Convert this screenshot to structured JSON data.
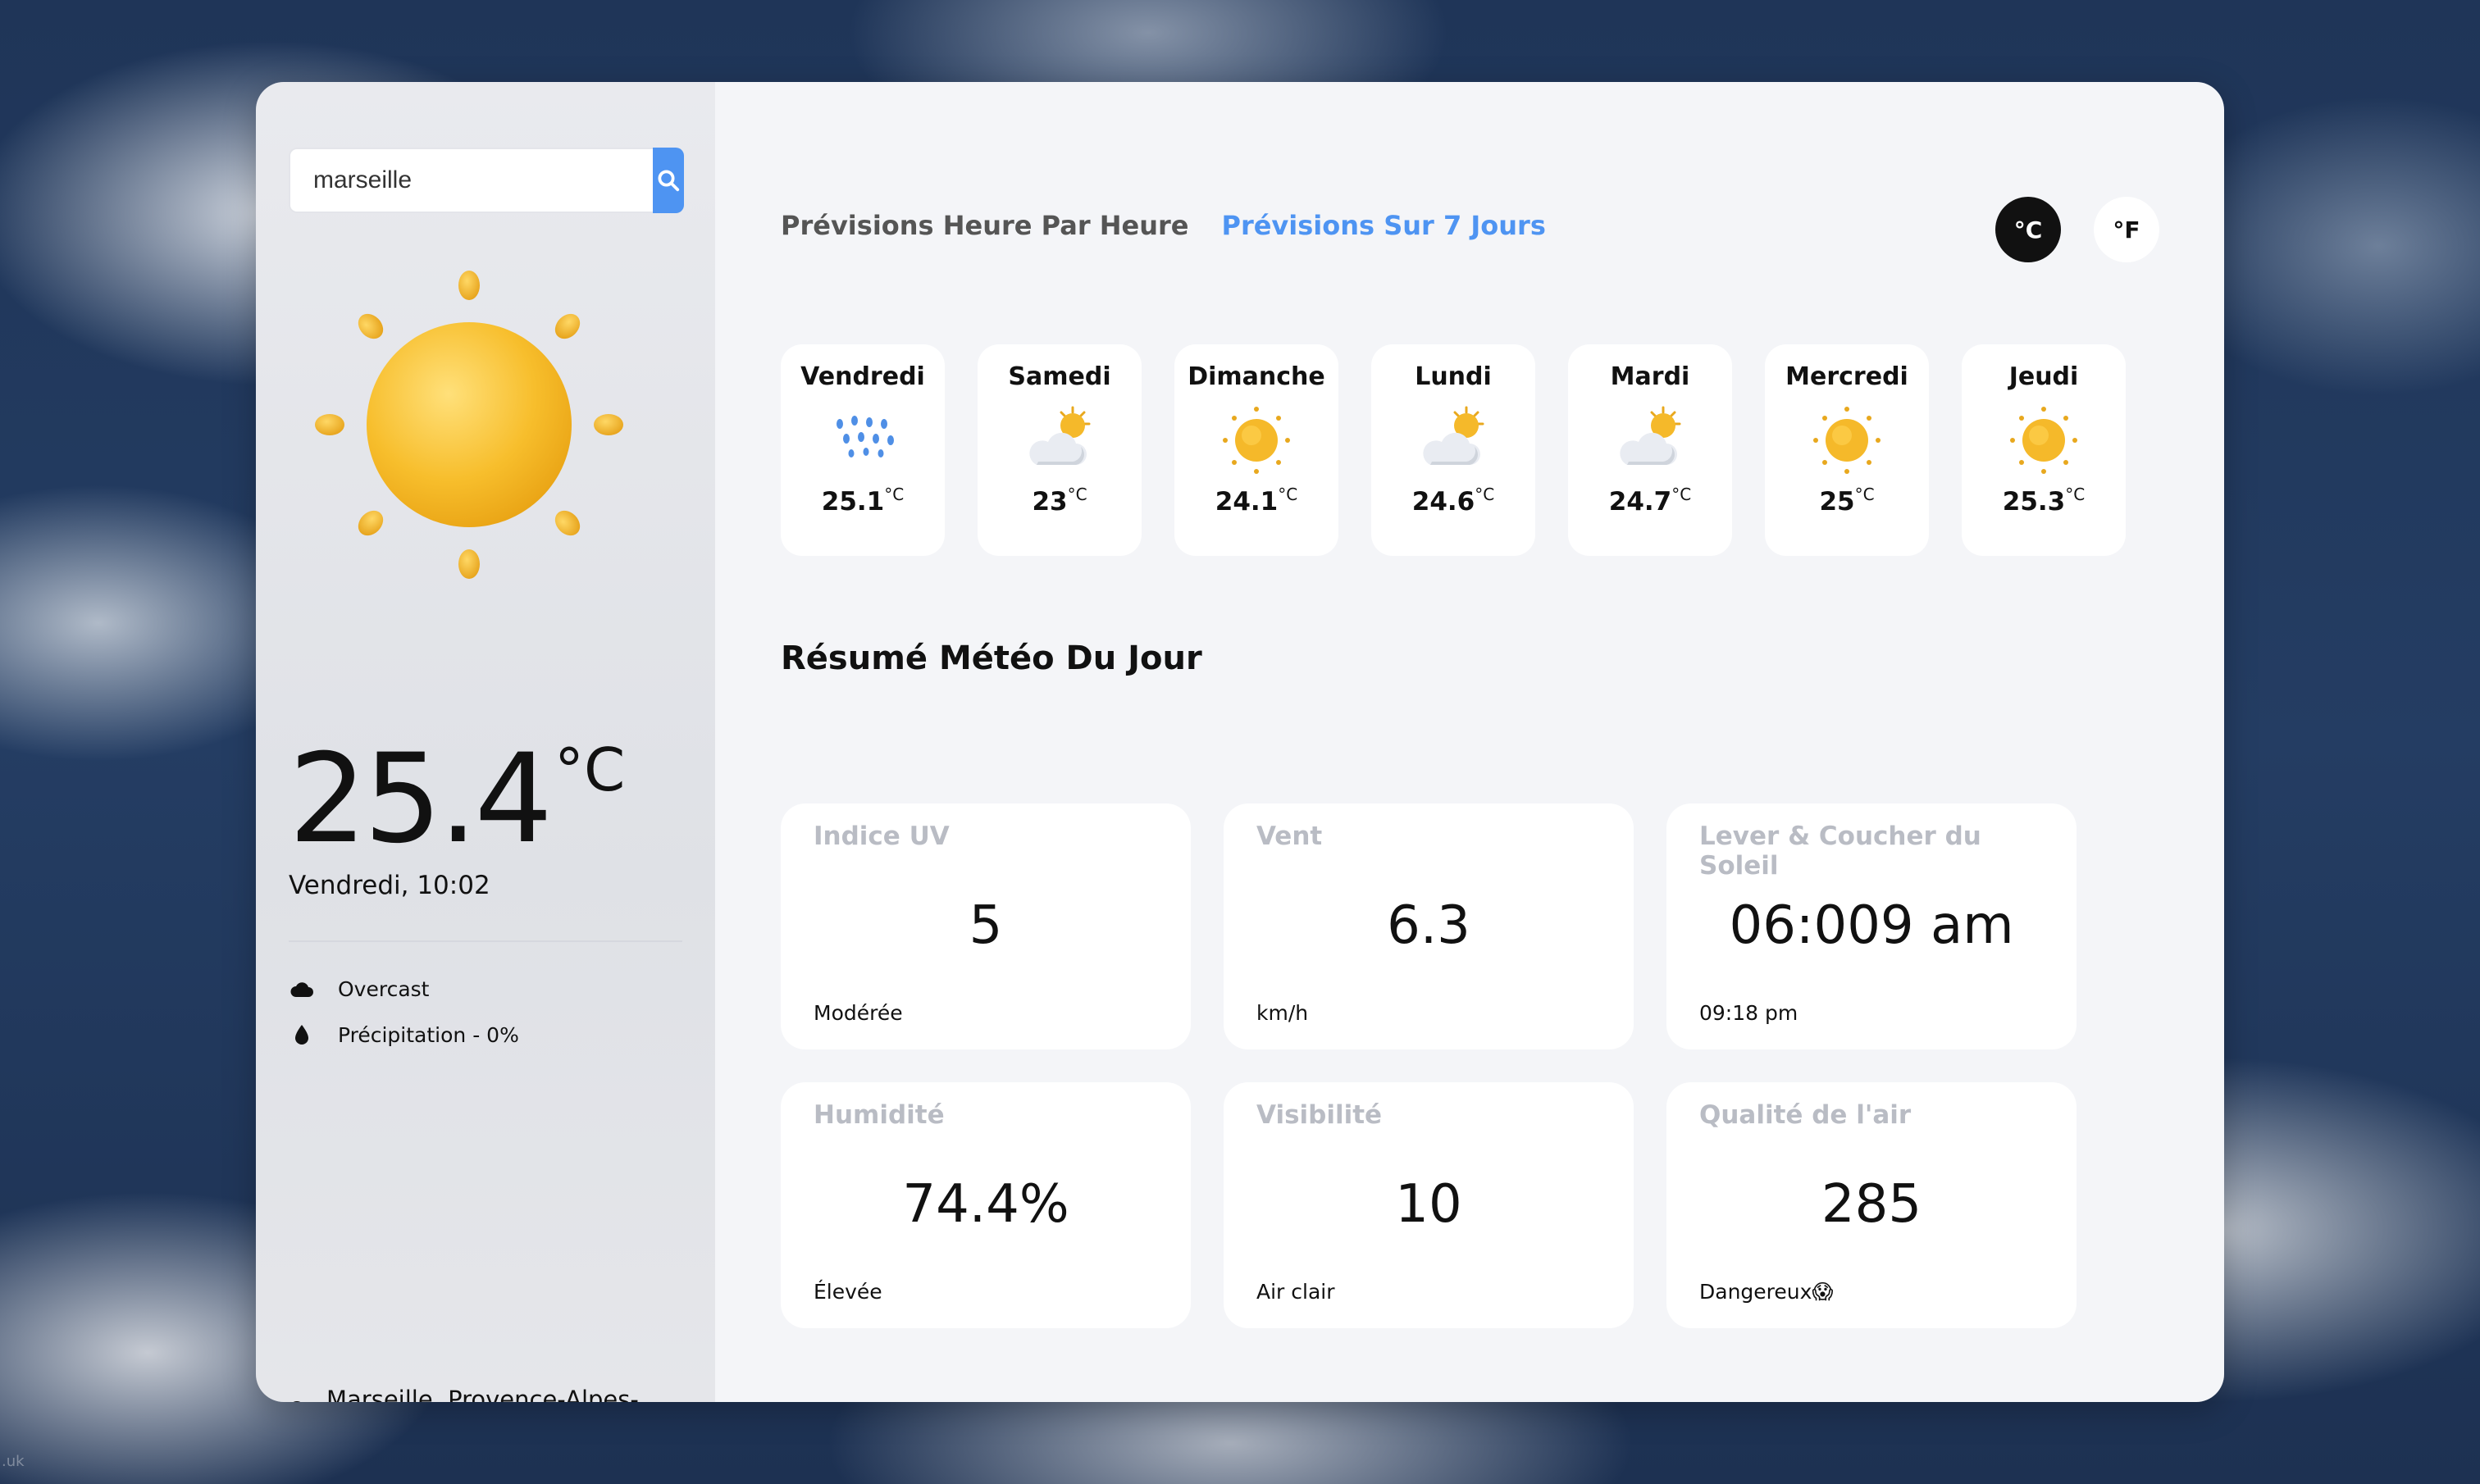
{
  "search": {
    "value": "marseille"
  },
  "current": {
    "temperature": "25.4",
    "unit": "°C",
    "datetime": "Vendredi, 10:02",
    "condition": "Overcast",
    "precipitation": "Précipitation - 0%",
    "location": "Marseille, Provence-Alpes-Côte d'Azur, France",
    "icon": "sun-icon"
  },
  "tabs": [
    {
      "label": "Prévisions Heure Par Heure",
      "active": false
    },
    {
      "label": "Prévisions Sur 7 Jours",
      "active": true
    }
  ],
  "units": {
    "celsius": "°C",
    "fahrenheit": "°F",
    "selected": "celsius"
  },
  "forecast": [
    {
      "day": "Vendredi",
      "temp": "25.1",
      "unit": "°C",
      "icon": "rain-icon"
    },
    {
      "day": "Samedi",
      "temp": "23",
      "unit": "°C",
      "icon": "partly-cloudy-icon"
    },
    {
      "day": "Dimanche",
      "temp": "24.1",
      "unit": "°C",
      "icon": "sun-icon"
    },
    {
      "day": "Lundi",
      "temp": "24.6",
      "unit": "°C",
      "icon": "partly-cloudy-icon"
    },
    {
      "day": "Mardi",
      "temp": "24.7",
      "unit": "°C",
      "icon": "partly-cloudy-icon"
    },
    {
      "day": "Mercredi",
      "temp": "25",
      "unit": "°C",
      "icon": "sun-icon"
    },
    {
      "day": "Jeudi",
      "temp": "25.3",
      "unit": "°C",
      "icon": "sun-icon"
    }
  ],
  "summary": {
    "title": "Résumé Météo Du Jour",
    "stats": [
      {
        "title": "Indice UV",
        "value": "5",
        "sub": "Modérée"
      },
      {
        "title": "Vent",
        "value": "6.3",
        "sub": "km/h"
      },
      {
        "title": "Lever & Coucher du Soleil",
        "value": "06:009 am",
        "sub": "09:18 pm"
      },
      {
        "title": "Humidité",
        "value": "74.4%",
        "sub": "Élevée"
      },
      {
        "title": "Visibilité",
        "value": "10",
        "sub": "Air clair"
      },
      {
        "title": "Qualité de l'air",
        "value": "285",
        "sub": "Dangereux😱"
      }
    ]
  },
  "watermark": ".uk",
  "colors": {
    "accent": "#4e94f2",
    "sun": "#f5b92a",
    "dark": "#111111"
  }
}
